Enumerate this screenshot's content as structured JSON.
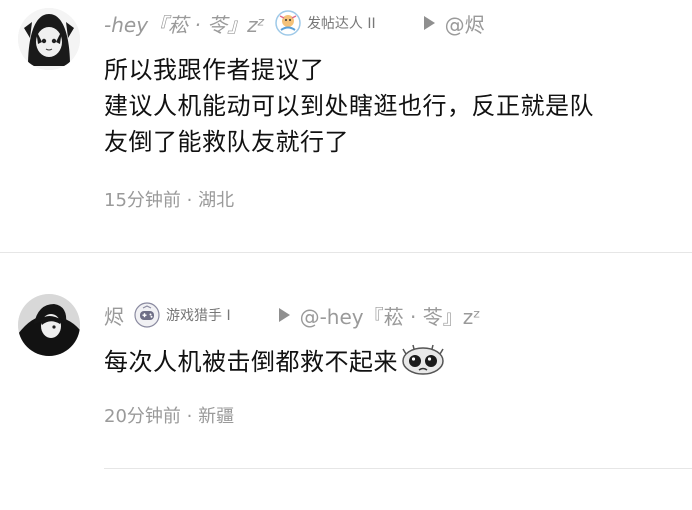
{
  "comments": [
    {
      "username": "-hey『菘 · 苓』zᶻ",
      "badge": {
        "icon": "mascot-badge-icon",
        "label": "发帖达人 II"
      },
      "reply_to": "@烬",
      "text_lines": [
        "所以我跟作者提议了",
        "建议人机能动可以到处瞎逛也行，反正就是队",
        "友倒了能救队友就行了"
      ],
      "footer": "15分钟前 · 湖北"
    },
    {
      "username": "烬",
      "badge": {
        "icon": "gamepad-badge-icon",
        "label": "游戏猎手 I"
      },
      "reply_to": "@-hey『菘 · 苓』zᶻ",
      "text": "每次人机被击倒都救不起来",
      "emoji": "crying-face-icon",
      "footer": "20分钟前 · 新疆"
    }
  ],
  "colors": {
    "meta_text": "#9a9a9a",
    "body_text": "#111111",
    "divider": "#e6e6e6"
  }
}
